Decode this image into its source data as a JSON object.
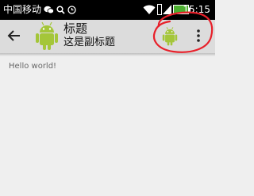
{
  "status_bar": {
    "carrier": "中国移动",
    "time": "15:15",
    "icons": [
      "wechat-icon",
      "search-icon",
      "clock-icon",
      "wifi-icon",
      "sim-icon",
      "signal-icon",
      "battery-icon"
    ]
  },
  "toolbar": {
    "title": "标题",
    "subtitle": "这是副标题",
    "icons": [
      "back-arrow-icon",
      "android-logo-icon",
      "android-action-icon",
      "overflow-menu-icon"
    ]
  },
  "content": {
    "text": "Hello world!"
  },
  "colors": {
    "android_green": "#a4c639",
    "toolbar_bg": "#dcdcdc",
    "highlight_red": "#e8202a"
  }
}
